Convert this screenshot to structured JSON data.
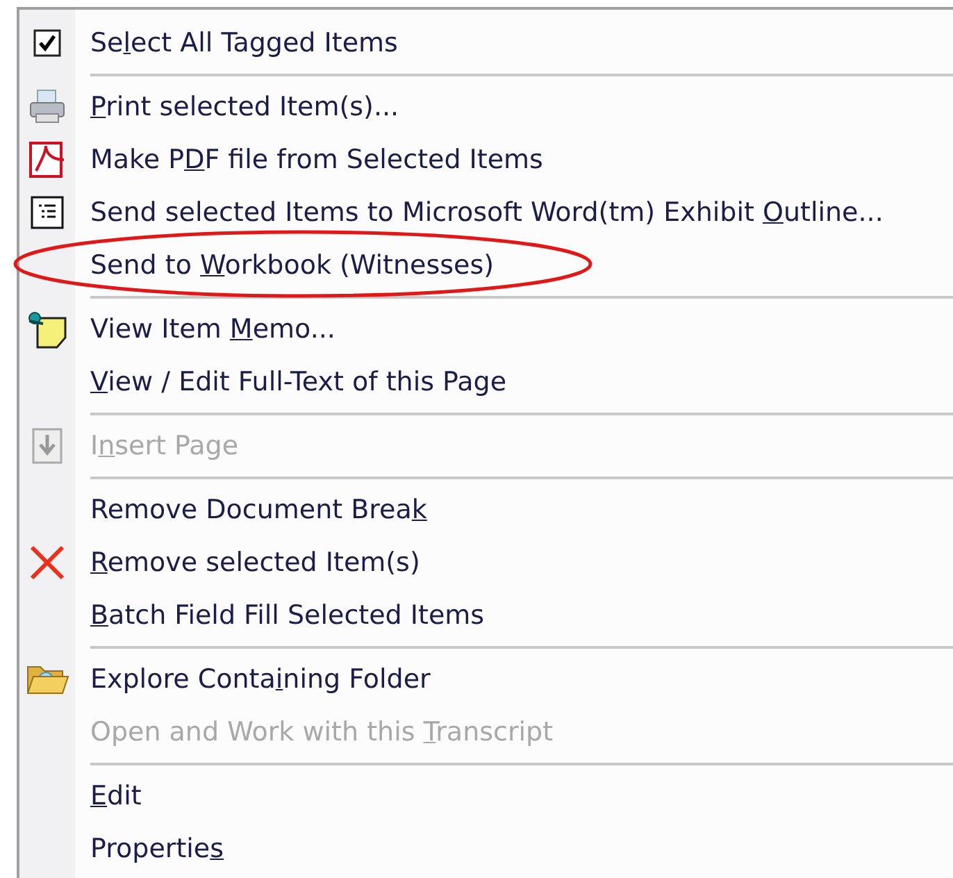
{
  "menu": {
    "items": [
      {
        "kind": "item",
        "checked": true,
        "disabled": false,
        "circled": false,
        "label": {
          "pre": "Se",
          "key": "l",
          "post": "ect All Tagged Items"
        }
      },
      {
        "kind": "separator"
      },
      {
        "kind": "item",
        "disabled": false,
        "circled": false,
        "label": {
          "key": "P",
          "post": "rint selected Item(s)..."
        }
      },
      {
        "kind": "item",
        "disabled": false,
        "circled": false,
        "label": {
          "pre": "Make P",
          "key": "D",
          "post": "F file from Selected Items"
        }
      },
      {
        "kind": "item",
        "disabled": false,
        "circled": false,
        "label": {
          "pre": "Send selected Items to Microsoft Word(tm) Exhibit ",
          "key": "O",
          "post": "utline..."
        }
      },
      {
        "kind": "item",
        "disabled": false,
        "circled": true,
        "label": {
          "pre": "Send to ",
          "key": "W",
          "post": "orkbook (Witnesses)"
        }
      },
      {
        "kind": "separator"
      },
      {
        "kind": "item",
        "disabled": false,
        "circled": false,
        "label": {
          "pre": "View Item ",
          "key": "M",
          "post": "emo..."
        }
      },
      {
        "kind": "item",
        "disabled": false,
        "circled": false,
        "label": {
          "key": "V",
          "post": "iew / Edit Full-Text of this Page"
        }
      },
      {
        "kind": "separator"
      },
      {
        "kind": "item",
        "disabled": true,
        "circled": false,
        "label": {
          "pre": "I",
          "key": "n",
          "post": "sert Page"
        }
      },
      {
        "kind": "separator"
      },
      {
        "kind": "item",
        "disabled": false,
        "circled": false,
        "label": {
          "pre": "Remove Document Brea",
          "key": "k"
        }
      },
      {
        "kind": "item",
        "disabled": false,
        "circled": false,
        "label": {
          "key": "R",
          "post": "emove selected Item(s)"
        }
      },
      {
        "kind": "item",
        "disabled": false,
        "circled": false,
        "label": {
          "key": "B",
          "post": "atch Field Fill Selected Items"
        }
      },
      {
        "kind": "separator"
      },
      {
        "kind": "item",
        "disabled": false,
        "circled": false,
        "label": {
          "pre": "Explore Conta",
          "key": "i",
          "post": "ning Folder"
        }
      },
      {
        "kind": "item",
        "disabled": true,
        "circled": false,
        "label": {
          "pre": "Open and Work with this ",
          "key": "T",
          "post": "ranscript"
        }
      },
      {
        "kind": "separator"
      },
      {
        "kind": "item",
        "disabled": false,
        "circled": false,
        "label": {
          "key": "E",
          "post": "dit"
        }
      },
      {
        "kind": "item",
        "disabled": false,
        "circled": false,
        "label": {
          "pre": "Propertie",
          "key": "s"
        }
      }
    ]
  }
}
